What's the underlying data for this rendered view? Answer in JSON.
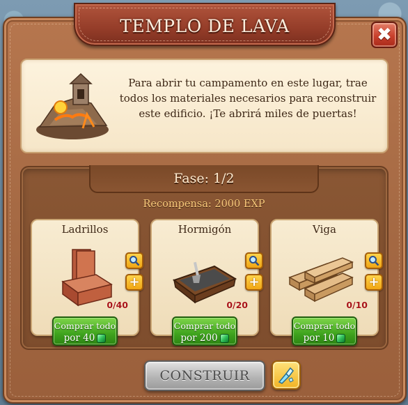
{
  "dialog": {
    "title": "TEMPLO DE LAVA",
    "description": "Para abrir tu campamento en este lugar, trae todos los materiales necesarios para reconstruir este edificio. ¡Te abrirá miles de puertas!",
    "phase": "Fase: 1/2",
    "reward": "Recompensa: 2000 EXP"
  },
  "materials": [
    {
      "name": "Ladrillos",
      "count": "0/40",
      "buy_line1": "Comprar todo",
      "buy_line2": "por 40",
      "icon": "bricks-icon"
    },
    {
      "name": "Hormigón",
      "count": "0/20",
      "buy_line1": "Comprar todo",
      "buy_line2": "por 200",
      "icon": "concrete-tray-icon"
    },
    {
      "name": "Viga",
      "count": "0/10",
      "buy_line1": "Comprar todo",
      "buy_line2": "por 10",
      "icon": "wood-beams-icon"
    }
  ],
  "actions": {
    "build_label": "CONSTRUIR",
    "close_glyph": "✖"
  },
  "colors": {
    "frame": "#a66a44",
    "title_ribbon": "#953d29",
    "panel_light": "#f6e6c8",
    "buy_green": "#3fa41e",
    "count_red": "#a8141a",
    "reward_gold": "#f6c87a"
  }
}
